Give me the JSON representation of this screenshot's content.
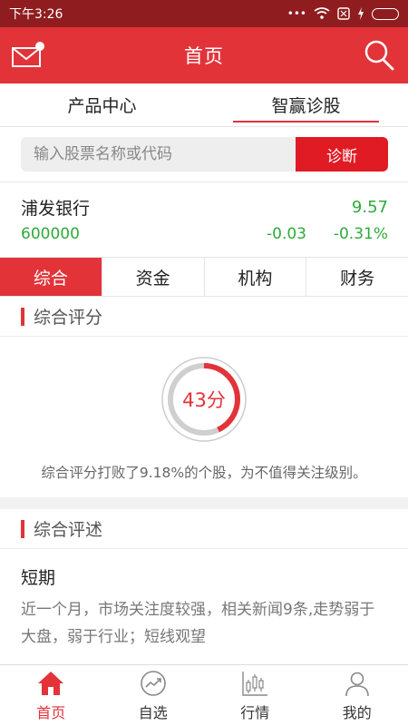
{
  "status_bar": {
    "time": "下午3:26",
    "icons": [
      "more-icon",
      "wifi-icon",
      "sim-icon",
      "charging-icon",
      "battery-icon"
    ]
  },
  "header": {
    "title": "首页",
    "left_icon": "mail-icon",
    "right_icon": "search-icon"
  },
  "top_tabs": [
    {
      "label": "产品中心",
      "active": false
    },
    {
      "label": "智赢诊股",
      "active": true
    }
  ],
  "search": {
    "placeholder": "输入股票名称或代码",
    "value": "",
    "button_label": "诊断"
  },
  "stock": {
    "name": "浦发银行",
    "price": "9.57",
    "code": "600000",
    "change": "-0.03",
    "change_pct": "-0.31%",
    "color": "#2eaa3a"
  },
  "sub_tabs": [
    {
      "label": "综合",
      "active": true
    },
    {
      "label": "资金",
      "active": false
    },
    {
      "label": "机构",
      "active": false
    },
    {
      "label": "财务",
      "active": false
    }
  ],
  "score_section": {
    "title": "综合评分",
    "score_label": "43分",
    "score_value": 43,
    "score_max": 100,
    "description": "综合评分打败了9.18%的个股，为不值得关注级别。"
  },
  "review_section": {
    "title": "综合评述",
    "term_title": "短期",
    "term_text": "近一个月，市场关注度较强，相关新闻9条,走势弱于大盘，弱于行业；短线观望"
  },
  "bottom_nav": [
    {
      "label": "首页",
      "icon": "home-icon",
      "active": true
    },
    {
      "label": "自选",
      "icon": "trend-icon",
      "active": false
    },
    {
      "label": "行情",
      "icon": "candlestick-icon",
      "active": false
    },
    {
      "label": "我的",
      "icon": "user-icon",
      "active": false
    }
  ],
  "colors": {
    "accent": "#e23339",
    "status_bar": "#8f1d1f",
    "gain_green": "#2eaa3a"
  }
}
